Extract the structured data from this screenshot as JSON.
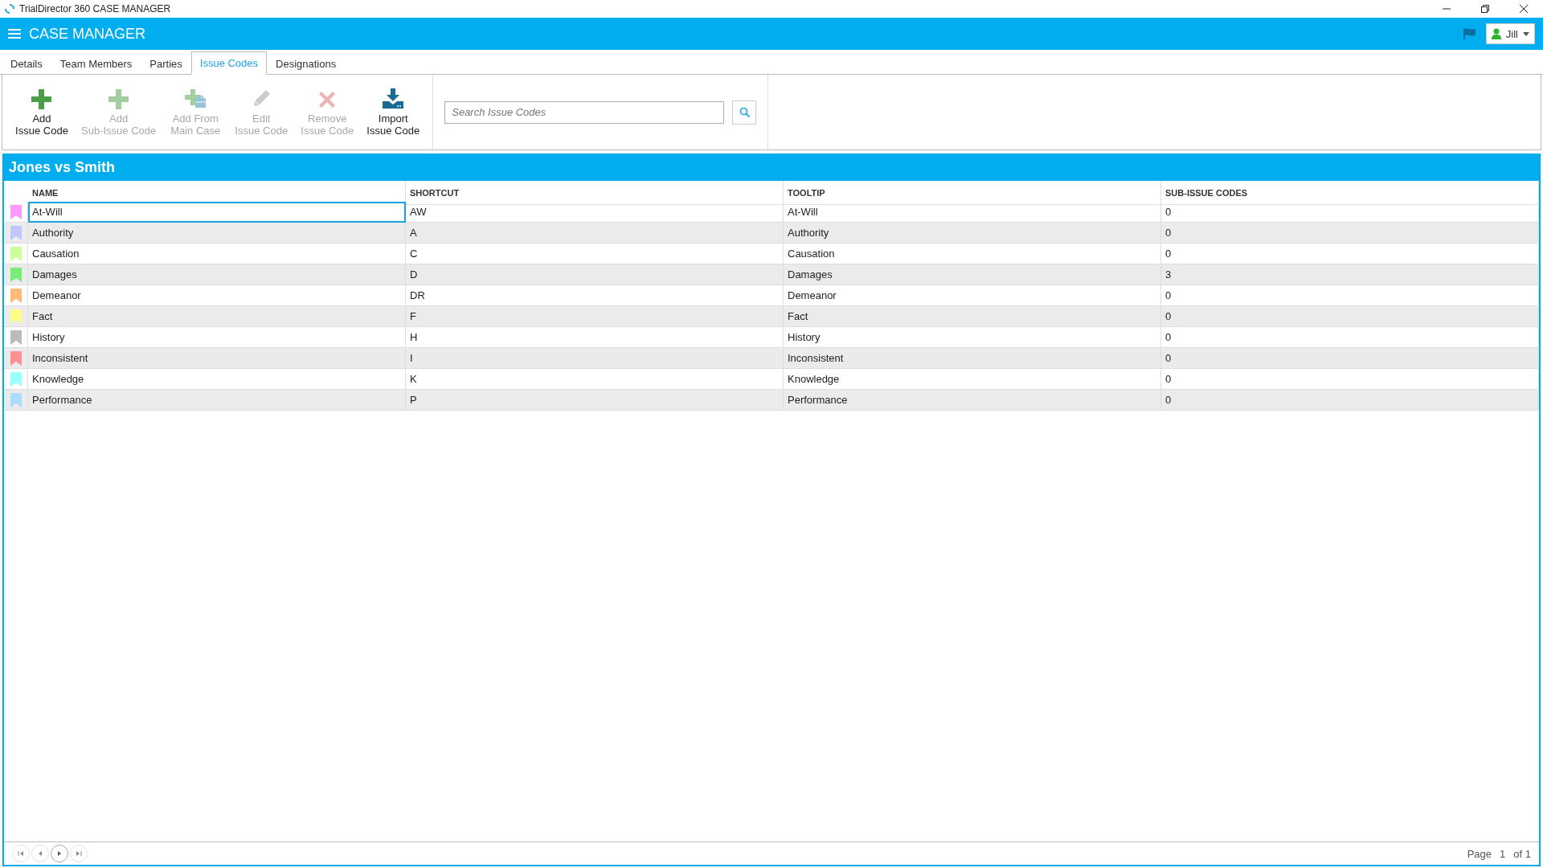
{
  "window": {
    "title": "TrialDirector 360 CASE MANAGER"
  },
  "header": {
    "title": "CASE MANAGER",
    "user": "Jill"
  },
  "tabs": [
    {
      "label": "Details",
      "selected": false
    },
    {
      "label": "Team Members",
      "selected": false
    },
    {
      "label": "Parties",
      "selected": false
    },
    {
      "label": "Issue Codes",
      "selected": true
    },
    {
      "label": "Designations",
      "selected": false
    }
  ],
  "toolbar": {
    "buttons": [
      {
        "kind": "add",
        "label": "Add\nIssue Code",
        "disabled": false
      },
      {
        "kind": "add",
        "label": "Add\nSub-Issue Code",
        "disabled": true
      },
      {
        "kind": "add-from",
        "label": "Add From\nMain Case",
        "disabled": true
      },
      {
        "kind": "edit",
        "label": "Edit\nIssue Code",
        "disabled": true
      },
      {
        "kind": "remove",
        "label": "Remove\nIssue Code",
        "disabled": true
      },
      {
        "kind": "import",
        "label": "Import\nIssue Code",
        "disabled": false
      }
    ],
    "search": {
      "placeholder": "Search Issue Codes"
    }
  },
  "case": {
    "title": "Jones vs Smith",
    "columns": [
      "NAME",
      "SHORTCUT",
      "TOOLTIP",
      "SUB-ISSUE CODES"
    ],
    "rows": [
      {
        "color": "#ff99ff",
        "name": "At-Will",
        "shortcut": "AW",
        "tooltip": "At-Will",
        "sub_issue_codes": "0",
        "selected": true
      },
      {
        "color": "#c4c4ff",
        "name": "Authority",
        "shortcut": "A",
        "tooltip": "Authority",
        "sub_issue_codes": "0",
        "selected": false
      },
      {
        "color": "#ccff99",
        "name": "Causation",
        "shortcut": "C",
        "tooltip": "Causation",
        "sub_issue_codes": "0",
        "selected": false
      },
      {
        "color": "#77ee77",
        "name": "Damages",
        "shortcut": "D",
        "tooltip": "Damages",
        "sub_issue_codes": "3",
        "selected": false
      },
      {
        "color": "#ffbb77",
        "name": "Demeanor",
        "shortcut": "DR",
        "tooltip": "Demeanor",
        "sub_issue_codes": "0",
        "selected": false
      },
      {
        "color": "#ffff88",
        "name": "Fact",
        "shortcut": "F",
        "tooltip": "Fact",
        "sub_issue_codes": "0",
        "selected": false
      },
      {
        "color": "#bbbbbb",
        "name": "History",
        "shortcut": "H",
        "tooltip": "History",
        "sub_issue_codes": "0",
        "selected": false
      },
      {
        "color": "#ff9090",
        "name": "Inconsistent",
        "shortcut": "I",
        "tooltip": "Inconsistent",
        "sub_issue_codes": "0",
        "selected": false
      },
      {
        "color": "#99ffff",
        "name": "Knowledge",
        "shortcut": "K",
        "tooltip": "Knowledge",
        "sub_issue_codes": "0",
        "selected": false
      },
      {
        "color": "#aaddff",
        "name": "Performance",
        "shortcut": "P",
        "tooltip": "Performance",
        "sub_issue_codes": "0",
        "selected": false
      }
    ]
  },
  "pager": {
    "buttons": [
      {
        "kind": "first",
        "disabled": true
      },
      {
        "kind": "prev",
        "disabled": true
      },
      {
        "kind": "next",
        "disabled": false
      },
      {
        "kind": "last",
        "disabled": true
      }
    ],
    "page_label": "Page",
    "page": "1",
    "of": "of 1"
  }
}
